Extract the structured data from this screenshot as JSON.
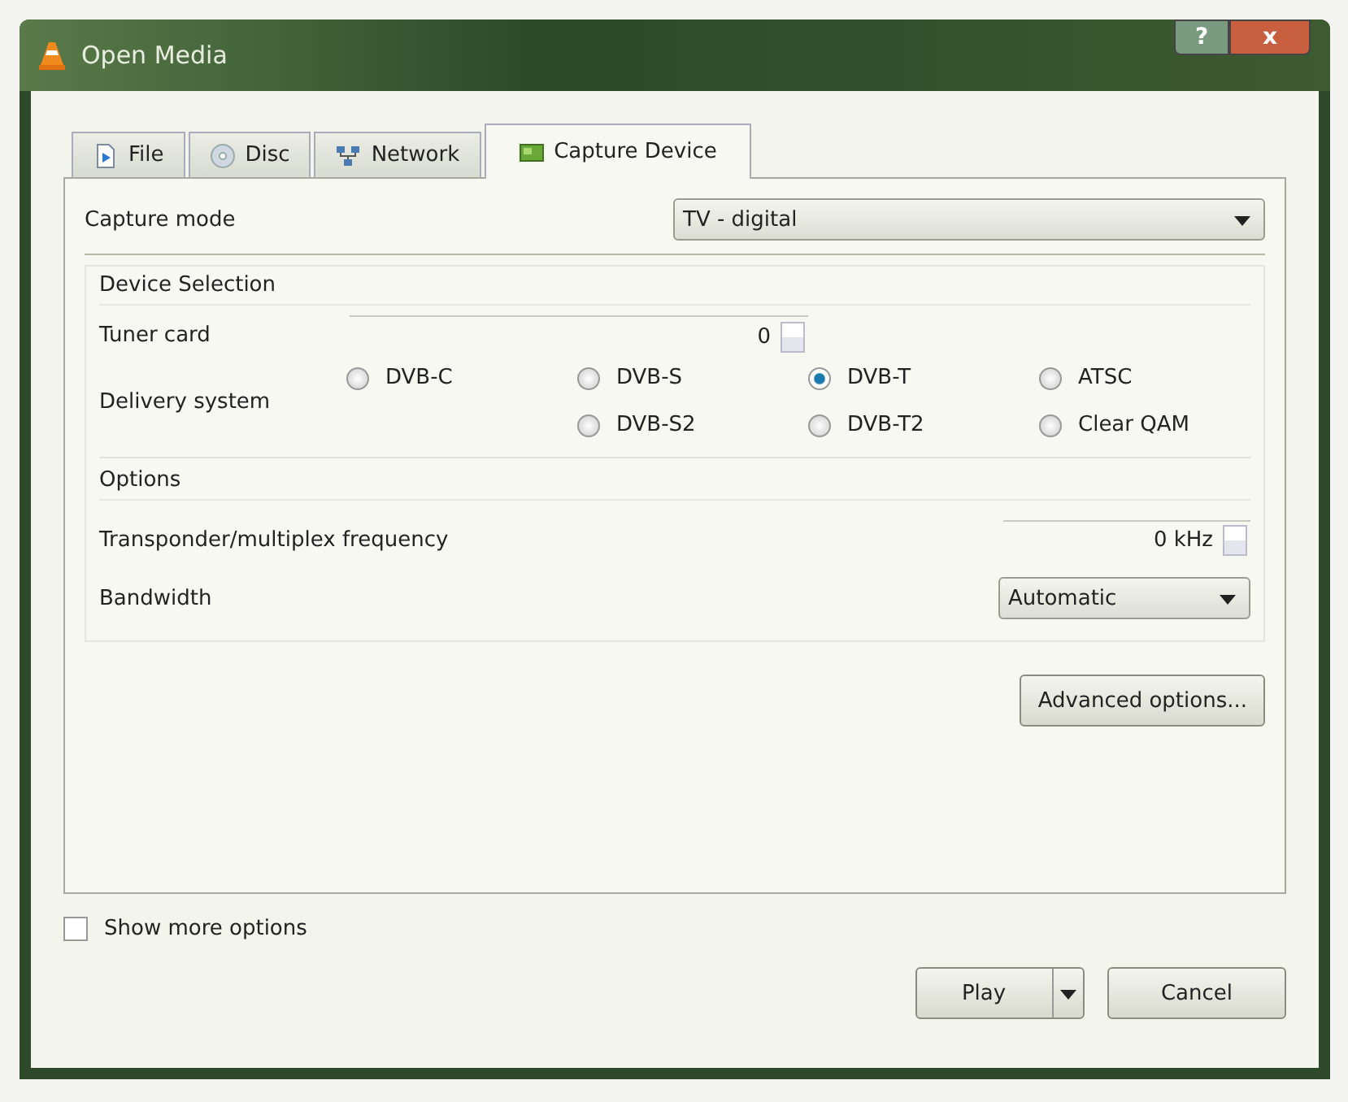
{
  "window": {
    "title": "Open Media",
    "help": "?",
    "close": "x"
  },
  "tabs": [
    {
      "label": "File",
      "kind": "file",
      "selected": false
    },
    {
      "label": "Disc",
      "kind": "disc",
      "selected": false
    },
    {
      "label": "Network",
      "kind": "network",
      "selected": false
    },
    {
      "label": "Capture Device",
      "kind": "capture",
      "selected": true
    }
  ],
  "capture_mode": {
    "label": "Capture mode",
    "value": "TV - digital"
  },
  "device_selection": {
    "title": "Device Selection",
    "tuner_label": "Tuner card",
    "tuner_value": "0",
    "delivery_label": "Delivery system",
    "options": [
      {
        "label": "DVB-C",
        "selected": false
      },
      {
        "label": "DVB-S",
        "selected": false
      },
      {
        "label": "DVB-T",
        "selected": true
      },
      {
        "label": "ATSC",
        "selected": false
      },
      {
        "label": "DVB-S2",
        "selected": false
      },
      {
        "label": "DVB-T2",
        "selected": false
      },
      {
        "label": "Clear QAM",
        "selected": false
      }
    ]
  },
  "options": {
    "title": "Options",
    "frequency_label": "Transponder/multiplex frequency",
    "frequency_value": "0 kHz",
    "bandwidth_label": "Bandwidth",
    "bandwidth_value": "Automatic"
  },
  "advanced_button": "Advanced options...",
  "show_more": {
    "label": "Show more options",
    "checked": false
  },
  "buttons": {
    "play": "Play",
    "cancel": "Cancel"
  }
}
